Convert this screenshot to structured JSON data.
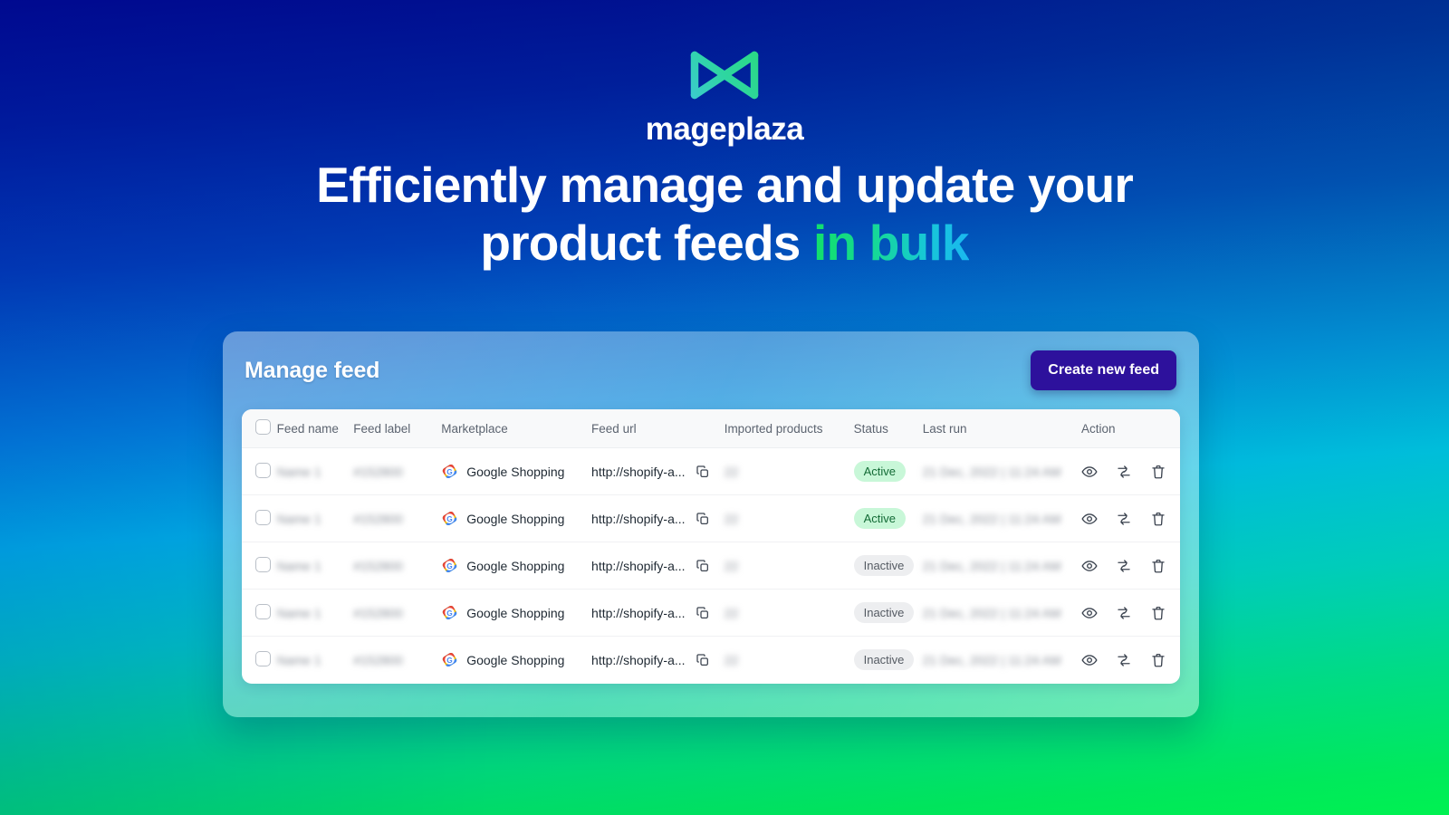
{
  "brand": {
    "logo_icon": "mageplaza-m-logo-icon",
    "wordmark": "mageplaza",
    "logo_gradient_from": "#3ec8d8",
    "logo_gradient_to": "#29d97e"
  },
  "headline": {
    "line1": "Efficiently manage and update your",
    "line2_plain": "product feeds ",
    "line2_accent": "in bulk",
    "accent_gradient_from": "#12e06a",
    "accent_gradient_to": "#1ab8f0"
  },
  "card": {
    "title": "Manage feed",
    "create_button": "Create new feed",
    "create_button_color": "#2d119c"
  },
  "table": {
    "columns": [
      "Feed name",
      "Feed label",
      "Marketplace",
      "Feed url",
      "Imported products",
      "Status",
      "Last run",
      "Action"
    ],
    "select_all_checkbox": "unchecked",
    "rows": [
      {
        "feed_name": "Name 1",
        "feed_label": "#152800",
        "marketplace": "Google Shopping",
        "marketplace_icon": "google-shopping-icon",
        "feed_url": "http://shopify-a...",
        "imported_products": "22",
        "status": "Active",
        "last_run": "21 Dec, 2022 | 11:24 AM",
        "blurred": [
          "feed_name",
          "feed_label",
          "imported_products",
          "last_run"
        ]
      },
      {
        "feed_name": "Name 1",
        "feed_label": "#152800",
        "marketplace": "Google Shopping",
        "marketplace_icon": "google-shopping-icon",
        "feed_url": "http://shopify-a...",
        "imported_products": "22",
        "status": "Active",
        "last_run": "21 Dec, 2022 | 11:24 AM",
        "blurred": [
          "feed_name",
          "feed_label",
          "imported_products",
          "last_run"
        ]
      },
      {
        "feed_name": "Name 1",
        "feed_label": "#152800",
        "marketplace": "Google Shopping",
        "marketplace_icon": "google-shopping-icon",
        "feed_url": "http://shopify-a...",
        "imported_products": "22",
        "status": "Inactive",
        "last_run": "21 Dec, 2022 | 11:24 AM",
        "blurred": [
          "feed_name",
          "feed_label",
          "imported_products",
          "last_run"
        ]
      },
      {
        "feed_name": "Name 1",
        "feed_label": "#152800",
        "marketplace": "Google Shopping",
        "marketplace_icon": "google-shopping-icon",
        "feed_url": "http://shopify-a...",
        "imported_products": "22",
        "status": "Inactive",
        "last_run": "21 Dec, 2022 | 11:24 AM",
        "blurred": [
          "feed_name",
          "feed_label",
          "imported_products",
          "last_run"
        ]
      },
      {
        "feed_name": "Name 1",
        "feed_label": "#152800",
        "marketplace": "Google Shopping",
        "marketplace_icon": "google-shopping-icon",
        "feed_url": "http://shopify-a...",
        "imported_products": "22",
        "status": "Inactive",
        "last_run": "21 Dec, 2022 | 11:24 AM",
        "blurred": [
          "feed_name",
          "feed_label",
          "imported_products",
          "last_run"
        ]
      }
    ],
    "row_actions": [
      "view-icon",
      "sync-icon",
      "delete-icon"
    ],
    "copy_icon": "copy-icon",
    "status_colors": {
      "active_bg": "#c8f7d8",
      "active_text": "#136b36",
      "inactive_bg": "#edeef0",
      "inactive_text": "#555b63"
    }
  }
}
